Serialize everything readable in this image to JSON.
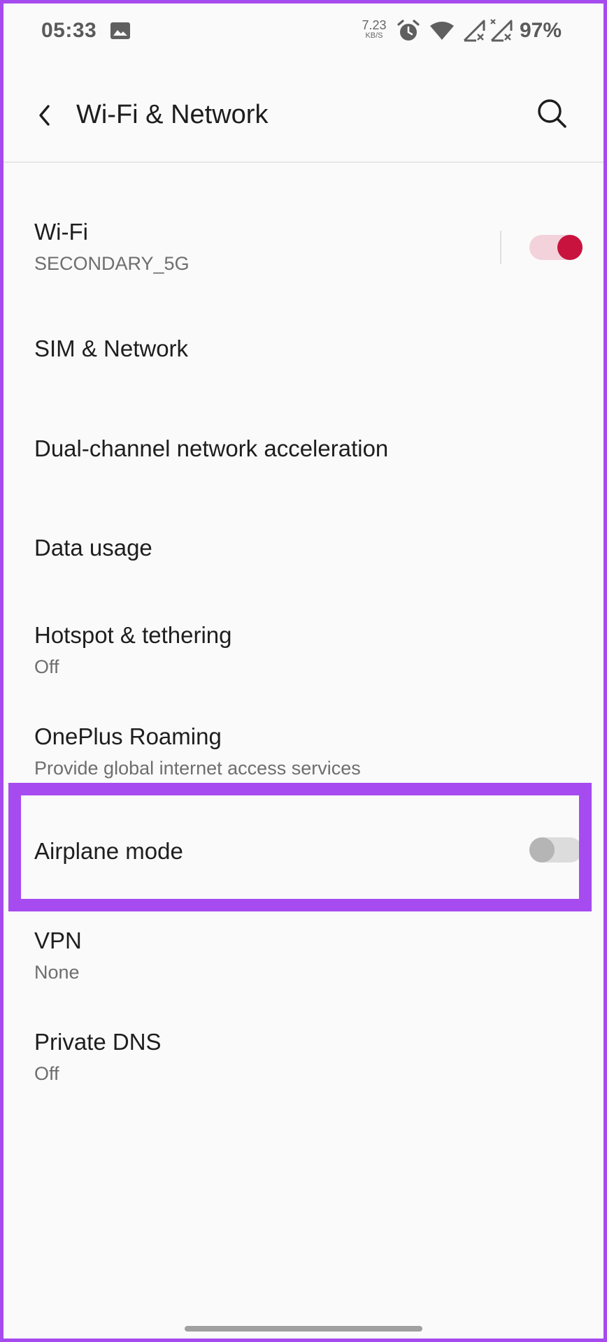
{
  "status_bar": {
    "time": "05:33",
    "net_speed": "7.23",
    "net_speed_unit": "KB/S",
    "battery": "97%",
    "icons": [
      "gallery-icon",
      "alarm-icon",
      "wifi-icon",
      "signal-x-icon",
      "signal-x-icon"
    ]
  },
  "app_bar": {
    "title": "Wi-Fi & Network"
  },
  "items": [
    {
      "title": "Wi-Fi",
      "subtitle": "SECONDARY_5G",
      "toggle": true
    },
    {
      "title": "SIM & Network"
    },
    {
      "title": "Dual-channel network acceleration"
    },
    {
      "title": "Data usage"
    },
    {
      "title": "Hotspot & tethering",
      "subtitle": "Off"
    },
    {
      "title": "OnePlus Roaming",
      "subtitle": "Provide global internet access services"
    },
    {
      "title": "Airplane mode",
      "toggle": false
    },
    {
      "title": "VPN",
      "subtitle": "None"
    },
    {
      "title": "Private DNS",
      "subtitle": "Off"
    }
  ],
  "colors": {
    "accent": "#c8133f",
    "accent_track": "#f3d2db",
    "highlight": "#a64bf0"
  }
}
